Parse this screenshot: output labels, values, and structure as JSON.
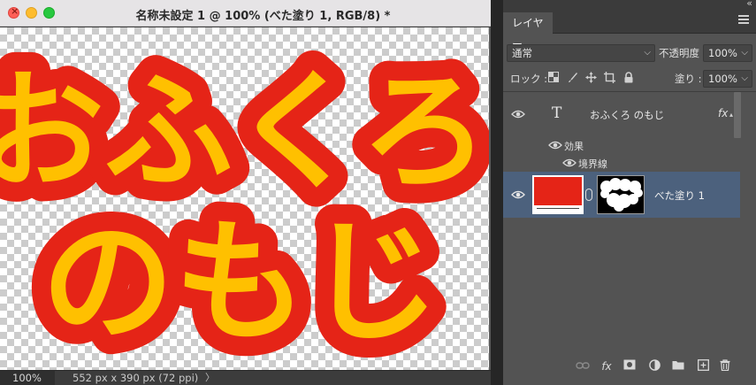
{
  "document": {
    "title": "名称未設定 1 @ 100% (べた塗り 1, RGB/8) *",
    "zoom": "100%",
    "info": "552 px x 390 px (72 ppi)",
    "artwork": {
      "line1": "おふくろ",
      "line2": "のもじ",
      "fill_color": "#ffc000",
      "stroke_color": "#e52417"
    }
  },
  "layers_panel": {
    "tab_label": "レイヤー",
    "blend_mode": "通常",
    "opacity_label": "不透明度 :",
    "opacity_value": "100%",
    "lock_label": "ロック :",
    "fill_label": "塗り :",
    "fill_value": "100%",
    "layers": {
      "text_layer": {
        "type_icon": "T",
        "name": "おふくろ のもじ",
        "fx_badge": "fx",
        "effects_label": "効果",
        "stroke_effect_label": "境界線"
      },
      "fill_layer": {
        "name": "べた塗り 1",
        "swatch_color": "#e52417"
      }
    },
    "bottom_icons": [
      "link-icon",
      "fx-icon",
      "mask-icon",
      "adjustment-icon",
      "folder-icon",
      "new-layer-icon",
      "trash-icon"
    ],
    "bottom_fx_label": "fx"
  },
  "colors": {
    "selection_highlight": "#4c617d",
    "panel_bg": "#535353"
  }
}
